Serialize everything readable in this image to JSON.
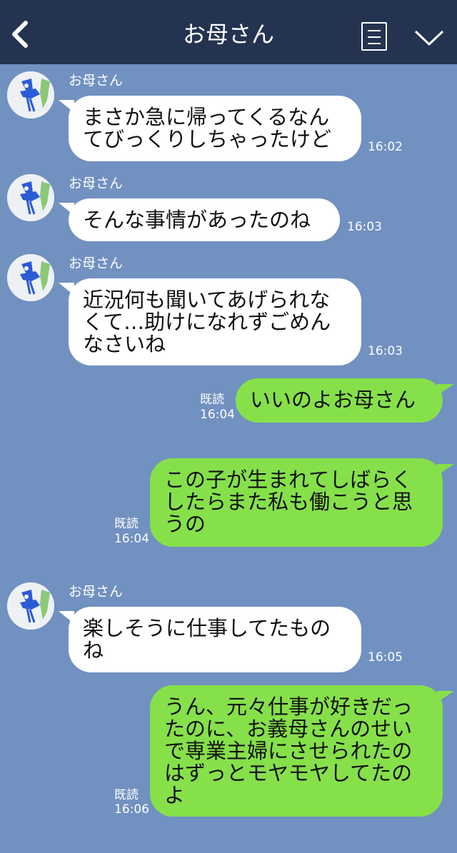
{
  "header": {
    "title": "お母さん",
    "back_icon": "chevron-left-icon",
    "menu_icon": "menu-list-icon",
    "dropdown_icon": "chevron-down-icon"
  },
  "messages": [
    {
      "sender": "お母さん",
      "text_lines": [
        "まさか急に帰ってくるなん",
        "てびっくりしちゃったけど"
      ],
      "time": "16:02"
    },
    {
      "sender": "お母さん",
      "text_lines": [
        "そんな事情があったのね"
      ],
      "time": "16:03"
    },
    {
      "sender": "お母さん",
      "text_lines": [
        "近況何も聞いてあげられな",
        "くて…助けになれずごめん",
        "なさいね"
      ],
      "time": "16:03"
    },
    {
      "read": "既読",
      "text_lines": [
        "いいのよお母さん"
      ],
      "time": "16:04"
    },
    {
      "read": "既読",
      "text_lines": [
        "この子が生まれてしばらく",
        "したらまた私も働こうと思",
        "うの"
      ],
      "time": "16:04"
    },
    {
      "sender": "お母さん",
      "text_lines": [
        "楽しそうに仕事してたもの",
        "ね"
      ],
      "time": "16:05"
    },
    {
      "read": "既読",
      "text_lines": [
        "うん、元々仕事が好きだっ",
        "たのに、お義母さんのせい",
        "で専業主婦にさせられたの",
        "はずっとモヤモヤしてたの",
        "よ"
      ],
      "time": "16:06"
    }
  ],
  "colors": {
    "header_bg": "#243350",
    "chat_bg": "#7191c1",
    "incoming_bubble": "#ffffff",
    "outgoing_bubble": "#86e04a"
  }
}
